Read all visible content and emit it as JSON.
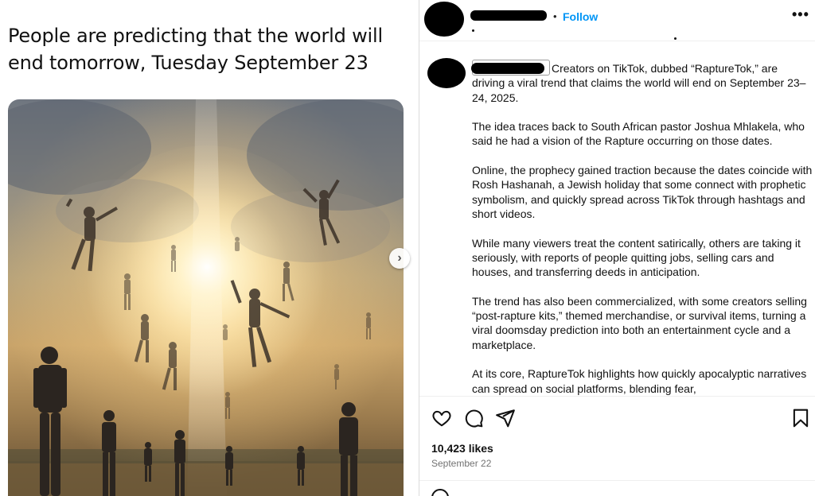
{
  "left_post": {
    "title": "People are predicting that the world will end tomorrow, Tuesday September 23"
  },
  "instagram": {
    "header": {
      "separator": "•",
      "follow_label": "Follow",
      "more_label": "•••"
    },
    "caption": {
      "paragraphs": [
        "Creators on TikTok, dubbed “RaptureTok,” are driving a viral trend that claims the world will end on September 23–24, 2025.",
        "The idea traces back to South African pastor Joshua Mhlakela, who said he had a vision of the Rapture occurring on those dates.",
        "Online, the prophecy gained traction because the dates coincide with Rosh Hashanah, a Jewish holiday that some connect with prophetic symbolism, and quickly spread across TikTok through hashtags and short videos.",
        "While many viewers treat the content satirically, others are taking it seriously, with reports of people quitting jobs, selling cars and houses, and transferring deeds in anticipation.",
        "The trend has also been commercialized, with some creators selling “post-rapture kits,” themed merchandise, or survival items, turning a viral doomsday prediction into both an entertainment cycle and a marketplace.",
        "At its core, RaptureTok highlights how quickly apocalyptic narratives can spread on social platforms, blending fear,"
      ]
    },
    "actions": {
      "icons": [
        "heart-icon",
        "comment-icon",
        "share-icon",
        "bookmark-icon"
      ]
    },
    "likes": "10,423 likes",
    "date": "September 22"
  },
  "colors": {
    "follow_blue": "#0095f6",
    "muted_text": "#737373",
    "border": "#dbdbdb"
  }
}
